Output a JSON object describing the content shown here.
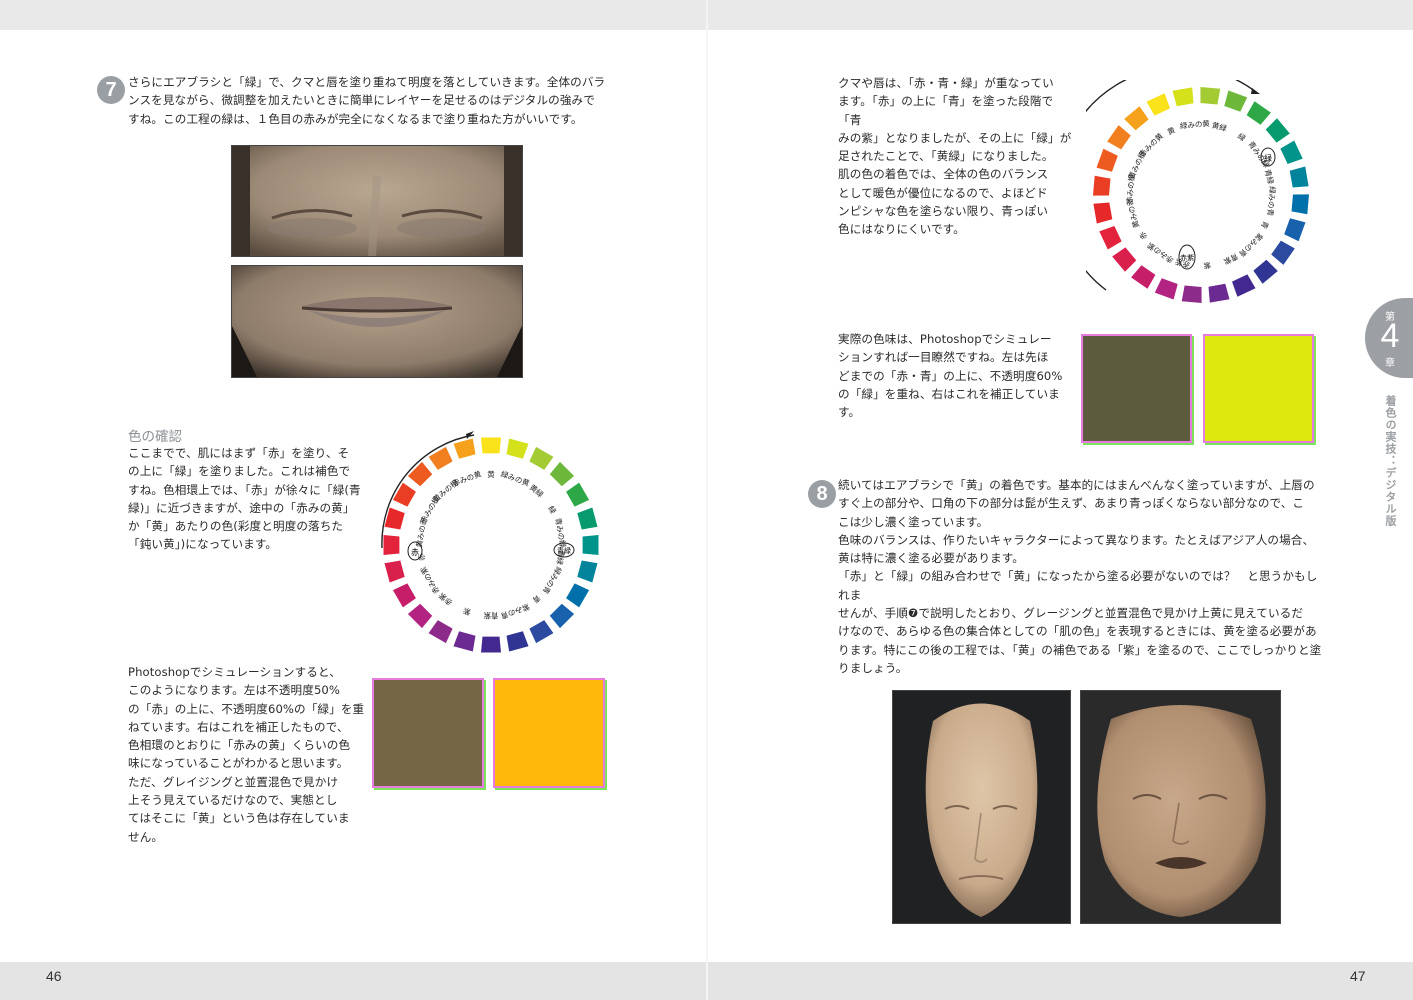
{
  "left_page": {
    "page_number": "46",
    "step7": {
      "number": "7",
      "text": "さらにエアブラシと「緑」で、クマと唇を塗り重ねて明度を落としていきます。全体のバラ\nンスを見ながら、微調整を加えたいときに簡単にレイヤーを足せるのはデジタルの強みで\nすね。この工程の緑は、１色目の赤みが完全になくなるまで塗り重ねた方がいいです。"
    },
    "color_check": {
      "heading": "色の確認",
      "text": "ここまでで、肌にはまず「赤」を塗り、そ\nの上に「緑」を塗りました。これは補色で\nすね。色相環上では、「赤」が徐々に「緑(青\n緑)」に近づきますが、途中の「赤みの黄」\nか「黄」あたりの色(彩度と明度の落ちた\n「鈍い黄」)になっています。"
    },
    "simulation": {
      "text": "Photoshopでシミュレーションすると、\nこのようになります。左は不透明度50%\nの「赤」の上に、不透明度60%の「緑」を重\nねています。右はこれを補正したもので、\n色相環のとおりに「赤みの黄」くらいの色\n味になっていることがわかると思います。\nただ、グレイジングと並置混色で見かけ\n上そう見えているだけなので、実態とし\nてはそこに「黄」という色は存在していま\nせん。",
      "swatch_left": "#756646",
      "swatch_right": "#ffb70a"
    },
    "wheel": {
      "labels": [
        "黄",
        "緑みの黄",
        "黄緑",
        "緑",
        "青みの緑",
        "青緑",
        "緑みの青",
        "青",
        "紫みの青",
        "青紫",
        "紫",
        "赤紫",
        "赤みの紫",
        "赤",
        "黄みの赤",
        "赤みの橙",
        "黄みの橙",
        "赤みの黄"
      ],
      "circled_a": "赤",
      "circled_b": "青緑"
    }
  },
  "right_page": {
    "page_number": "47",
    "intro": {
      "text": "クマや唇は、「赤・青・緑」が重なってい\nます。「赤」の上に「青」を塗った段階で「青\nみの紫」となりましたが、その上に「緑」が\n足されたことで、「黄緑」になりました。\n肌の色の着色では、全体の色のバランス\nとして暖色が優位になるので、よほどド\nンピシャな色を塗らない限り、青っぽい\n色にはなりにくいです。"
    },
    "simulation": {
      "text": "実際の色味は、Photoshopでシミュレー\nションすれば一目瞭然ですね。左は先ほ\nどまでの「赤・青」の上に、不透明度60%\nの「緑」を重ね、右はこれを補正していま\nす。",
      "swatch_left": "#5c5b3e",
      "swatch_right": "#dde90c"
    },
    "step8": {
      "number": "8",
      "text": "続いてはエアブラシで「黄」の着色です。基本的にはまんべんなく塗っていますが、上唇の\nすぐ上の部分や、口角の下の部分は髭が生えず、あまり青っぽくならない部分なので、こ\nこは少し濃く塗っています。\n色味のバランスは、作りたいキャラクターによって異なります。たとえばアジア人の場合、\n黄は特に濃く塗る必要があります。\n「赤」と「緑」の組み合わせで「黄」になったから塗る必要がないのでは？　と思うかもしれま\nせんが、手順❼で説明したとおり、グレージングと並置混色で見かけ上黄に見えているだ\nけなので、あらゆる色の集合体としての「肌の色」を表現するときには、黄を塗る必要があ\nります。特にこの後の工程では、「黄」の補色である「紫」を塗るので、ここでしっかりと塗\nりましょう。"
    },
    "wheel": {
      "circled_a": "緑",
      "circled_b": "赤紫"
    },
    "chapter": {
      "prefix": "第",
      "number": "4",
      "suffix": "章",
      "title": "着色の実技：デジタル版"
    }
  },
  "colors": {
    "wheel": [
      "#f9e21a",
      "#d5e11b",
      "#a3cb33",
      "#6db73a",
      "#2ea847",
      "#079a6e",
      "#00948a",
      "#00849b",
      "#0070aa",
      "#1761ad",
      "#2b4aa0",
      "#303493",
      "#43288f",
      "#6a2a91",
      "#8d2b8b",
      "#b32482",
      "#c71e6a",
      "#d9204c",
      "#e2233b",
      "#e6282b",
      "#ea3e24",
      "#ed5b21",
      "#f17e1f",
      "#f5a11b"
    ]
  }
}
